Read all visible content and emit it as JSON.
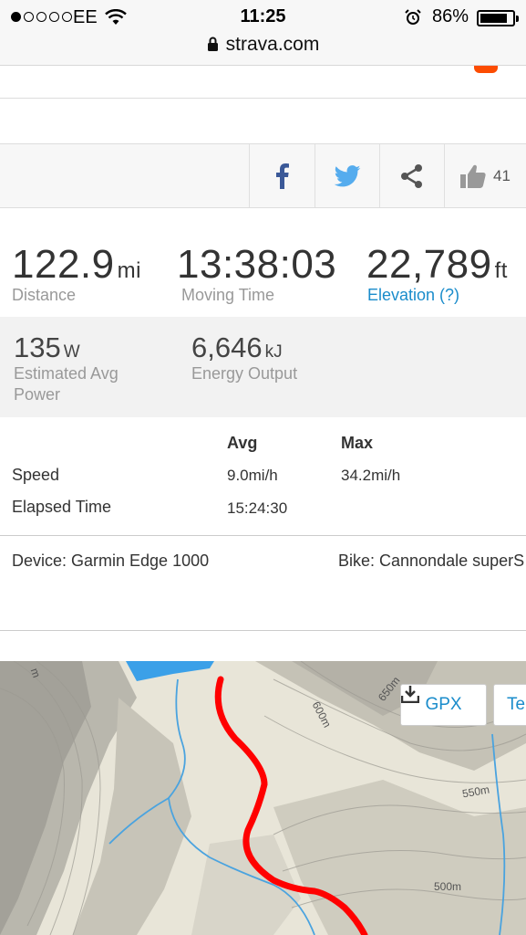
{
  "status_bar": {
    "carrier": "EE",
    "time": "11:25",
    "battery": "86%",
    "battery_level": 0.86
  },
  "browser": {
    "url": "strava.com"
  },
  "social": {
    "kudos_count": "41"
  },
  "primary_stats": [
    {
      "value": "122.9",
      "unit": "mi",
      "label": "Distance"
    },
    {
      "value": "13:38:03",
      "unit": "",
      "label": "Moving Time"
    },
    {
      "value": "22,789",
      "unit": "ft",
      "label": "Elevation (?)"
    }
  ],
  "secondary_stats": [
    {
      "value": "135",
      "unit": "W",
      "label_line1": "Estimated Avg",
      "label_line2": "Power"
    },
    {
      "value": "6,646",
      "unit": "kJ",
      "label_line1": "Energy Output",
      "label_line2": ""
    }
  ],
  "table": {
    "headers": {
      "avg": "Avg",
      "max": "Max"
    },
    "rows": [
      {
        "label": "Speed",
        "avg": "9.0mi/h",
        "max": "34.2mi/h"
      },
      {
        "label": "Elapsed Time",
        "avg": "15:24:30",
        "max": ""
      }
    ]
  },
  "equipment": {
    "device": "Device: Garmin Edge 1000",
    "bike": "Bike: Cannondale superS"
  },
  "map": {
    "gpx_button": "GPX",
    "second_button": "Te",
    "contour_labels": [
      "600m",
      "650m",
      "550m",
      "500m",
      "m"
    ],
    "route_color": "#ff0000",
    "water_color": "#3ba0e8"
  },
  "colors": {
    "accent": "#1a8ccb",
    "strava_orange": "#fc4c02",
    "facebook": "#3b5998",
    "twitter": "#55acee"
  }
}
